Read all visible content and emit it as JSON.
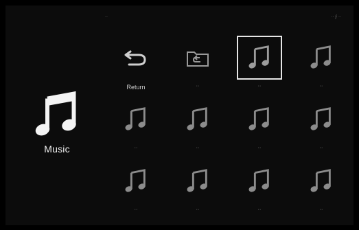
{
  "header": {
    "left_text": "··",
    "right_text": "·· ƒ ··"
  },
  "category": {
    "label": "Music",
    "icon": "music-note-icon"
  },
  "grid": {
    "items": [
      {
        "label": "Return",
        "icon": "return-arrow-icon"
      },
      {
        "label": "··",
        "icon": "folder-up-icon"
      },
      {
        "label": "··",
        "icon": "music-note-icon",
        "selected": true
      },
      {
        "label": "··",
        "icon": "music-note-icon"
      },
      {
        "label": "··",
        "icon": "music-note-icon"
      },
      {
        "label": "··",
        "icon": "music-note-icon"
      },
      {
        "label": "··",
        "icon": "music-note-icon"
      },
      {
        "label": "··",
        "icon": "music-note-icon"
      },
      {
        "label": "··",
        "icon": "music-note-icon"
      },
      {
        "label": "··",
        "icon": "music-note-icon"
      },
      {
        "label": "··",
        "icon": "music-note-icon"
      },
      {
        "label": "··",
        "icon": "music-note-icon"
      }
    ]
  },
  "colors": {
    "background": "#0c0c0c",
    "selection_border": "#e6e6e6",
    "icon_gray": "#8c8c8c"
  }
}
